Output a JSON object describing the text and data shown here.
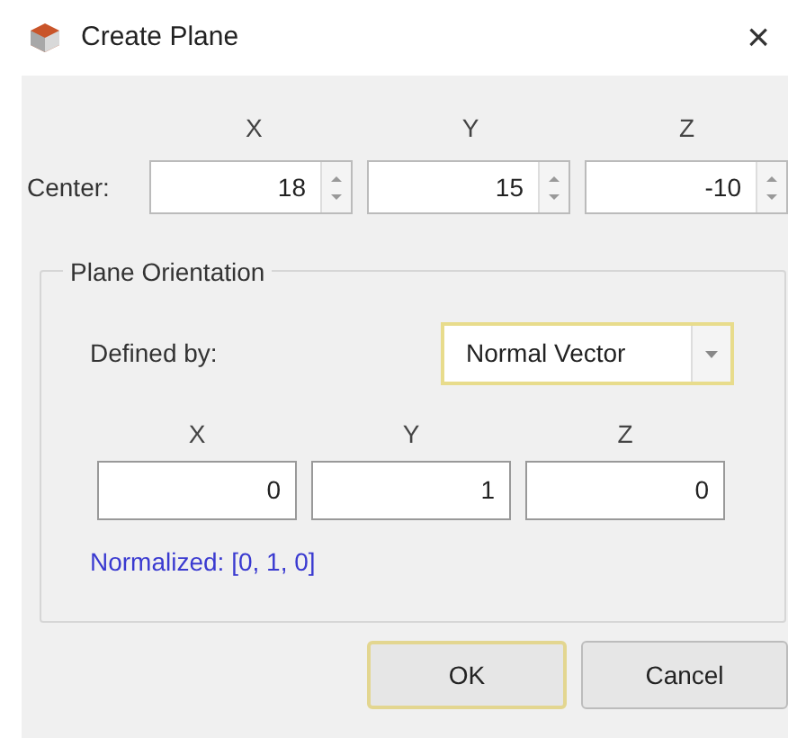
{
  "window": {
    "title": "Create Plane",
    "close": "×"
  },
  "center": {
    "label": "Center:",
    "columns": [
      "X",
      "Y",
      "Z"
    ],
    "values": [
      "18",
      "15",
      "-10"
    ]
  },
  "orientation": {
    "title": "Plane Orientation",
    "defined_by_label": "Defined by:",
    "defined_by": "Normal Vector",
    "columns": [
      "X",
      "Y",
      "Z"
    ],
    "values": [
      "0",
      "1",
      "0"
    ],
    "normalized": "Normalized: [0, 1, 0]"
  },
  "buttons": [
    {
      "label": "OK",
      "default": true
    },
    {
      "label": "Cancel",
      "default": false
    }
  ]
}
